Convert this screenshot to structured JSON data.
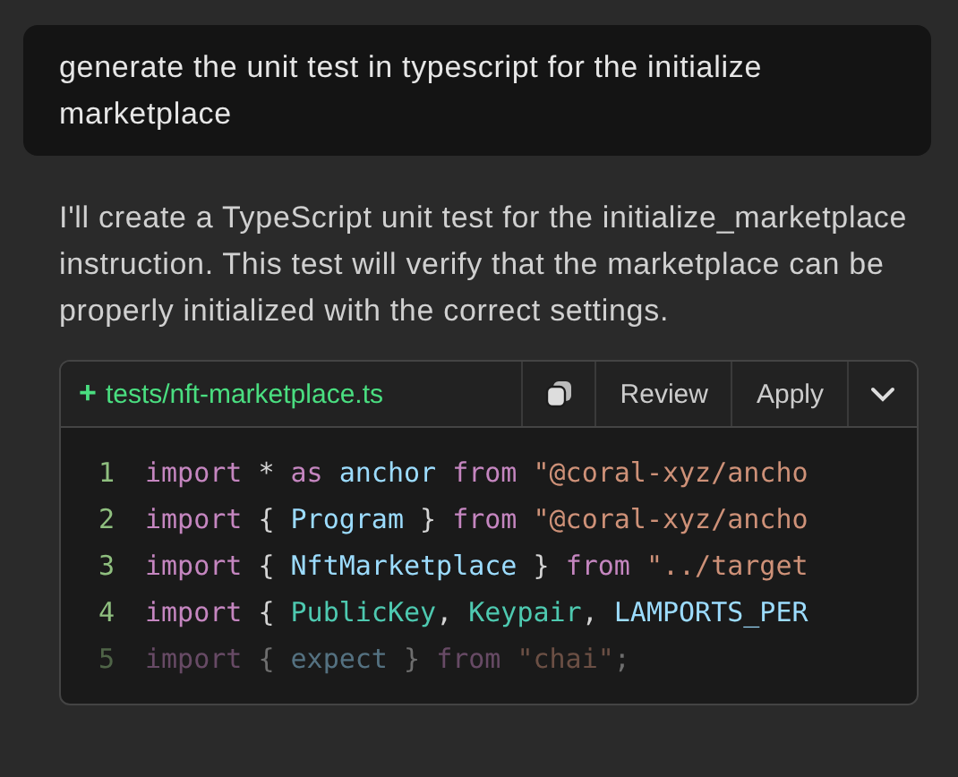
{
  "user_message": "generate the unit test in typescript for the initialize marketplace",
  "assistant_message": "I'll create a TypeScript unit test for the initialize_marketplace instruction. This test will verify that the marketplace can be properly initialized with the correct settings.",
  "code_block": {
    "file_status": "+",
    "file_path": "tests/nft-marketplace.ts",
    "actions": [
      "Review",
      "Apply"
    ],
    "lines": [
      {
        "number": "1",
        "faded": false,
        "tokens": [
          {
            "kind": "keyword",
            "text": "import"
          },
          {
            "kind": "plain",
            "text": " * "
          },
          {
            "kind": "keyword",
            "text": "as "
          },
          {
            "kind": "ident",
            "text": "anchor "
          },
          {
            "kind": "keyword",
            "text": "from "
          },
          {
            "kind": "string",
            "text": "\"@coral-xyz/ancho"
          }
        ]
      },
      {
        "number": "2",
        "faded": false,
        "tokens": [
          {
            "kind": "keyword",
            "text": "import"
          },
          {
            "kind": "plain",
            "text": " { "
          },
          {
            "kind": "ident",
            "text": "Program"
          },
          {
            "kind": "plain",
            "text": " } "
          },
          {
            "kind": "keyword",
            "text": "from "
          },
          {
            "kind": "string",
            "text": "\"@coral-xyz/ancho"
          }
        ]
      },
      {
        "number": "3",
        "faded": false,
        "tokens": [
          {
            "kind": "keyword",
            "text": "import"
          },
          {
            "kind": "plain",
            "text": " { "
          },
          {
            "kind": "ident",
            "text": "NftMarketplace"
          },
          {
            "kind": "plain",
            "text": " } "
          },
          {
            "kind": "keyword",
            "text": "from "
          },
          {
            "kind": "string",
            "text": "\"../target"
          }
        ]
      },
      {
        "number": "4",
        "faded": false,
        "tokens": [
          {
            "kind": "keyword",
            "text": "import"
          },
          {
            "kind": "plain",
            "text": " { "
          },
          {
            "kind": "type",
            "text": "PublicKey"
          },
          {
            "kind": "plain",
            "text": ", "
          },
          {
            "kind": "type",
            "text": "Keypair"
          },
          {
            "kind": "plain",
            "text": ", "
          },
          {
            "kind": "ident",
            "text": "LAMPORTS_PER"
          }
        ]
      },
      {
        "number": "5",
        "faded": true,
        "tokens": [
          {
            "kind": "keyword",
            "text": "import"
          },
          {
            "kind": "plain",
            "text": " { "
          },
          {
            "kind": "ident",
            "text": "expect"
          },
          {
            "kind": "plain",
            "text": " } "
          },
          {
            "kind": "keyword",
            "text": "from "
          },
          {
            "kind": "string",
            "text": "\"chai\""
          },
          {
            "kind": "plain",
            "text": ";"
          }
        ]
      }
    ]
  }
}
